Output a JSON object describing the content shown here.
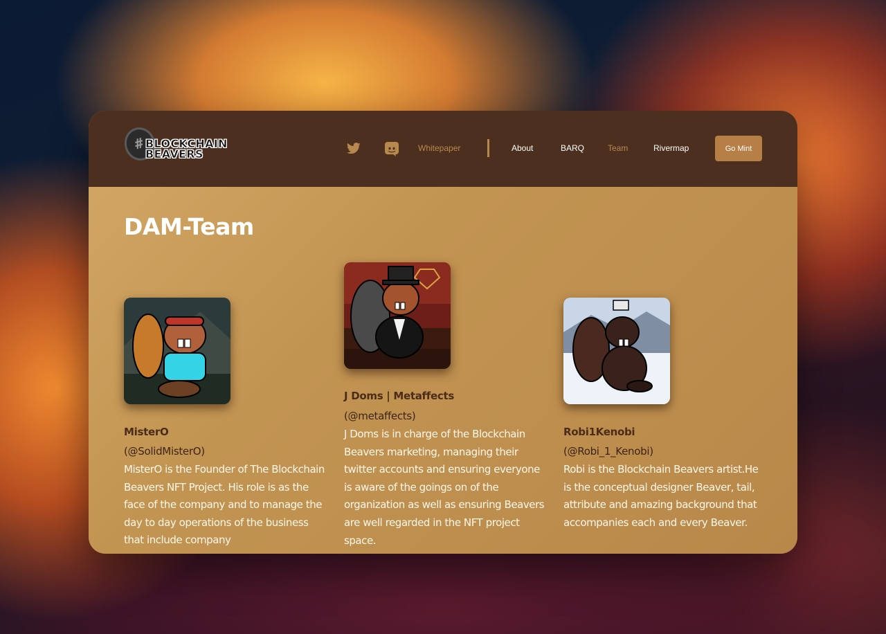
{
  "navbar": {
    "logo_text_line1": "BLOCKCHAIN",
    "logo_text_line2": "BEAVERS",
    "icons": [
      "twitter-icon",
      "discord-icon"
    ],
    "links": {
      "whitepaper": "Whitepaper",
      "about": "About",
      "barq": "BARQ",
      "team": "Team",
      "rivermap": "Rivermap"
    },
    "cta": "Go Mint"
  },
  "page": {
    "title": "DAM-Team"
  },
  "team": [
    {
      "name": "MisterO",
      "handle": "(@SolidMisterO)",
      "bio": "MisterO is the Founder of The Blockchain Beavers NFT Project. His role is as the face of the company and to manage the day to day operations of the business that include company"
    },
    {
      "name": "J Doms | Metaffects",
      "handle": "(@metaffects)",
      "bio": "J Doms is in charge of the Blockchain Beavers marketing, managing their twitter accounts and ensuring everyone is aware of the goings on of the organization as well as ensuring Beavers are well regarded in the NFT project space."
    },
    {
      "name": "Robi1Kenobi",
      "handle": "(@Robi_1_Kenobi)",
      "bio": "Robi is the Blockchain Beavers artist.He is the conceptual designer Beaver, tail, attribute and amazing background that accompanies each and every Beaver."
    }
  ],
  "colors": {
    "navbar_bg": "#4c2f1f",
    "accent": "#b8894f",
    "cta_bg": "#b57f46",
    "content_bg": "#c29452"
  }
}
